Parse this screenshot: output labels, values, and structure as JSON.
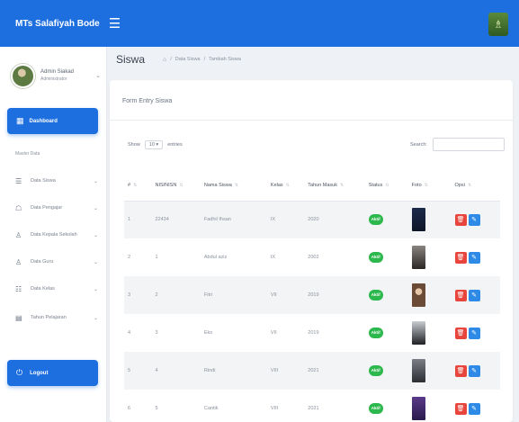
{
  "app": {
    "brand": "MTs Salafiyah Bode"
  },
  "profile": {
    "name": "Admin Siakad",
    "role": "Administrator"
  },
  "sidebar": {
    "dashboard_label": "Dashboard",
    "section_label": "Master Data",
    "items": [
      {
        "label": "Data Siswa",
        "icon": "users-icon",
        "glyph": "☰"
      },
      {
        "label": "Data Pengajar",
        "icon": "user-icon",
        "glyph": "☖"
      },
      {
        "label": "Data Kepala Sekolah",
        "icon": "user-tie-icon",
        "glyph": "♙"
      },
      {
        "label": "Data Guru",
        "icon": "user-icon",
        "glyph": "♙"
      },
      {
        "label": "Data Kelas",
        "icon": "group-icon",
        "glyph": "☷"
      },
      {
        "label": "Tahun Pelajaran",
        "icon": "calendar-icon",
        "glyph": "▤"
      }
    ],
    "logout_label": "Logout"
  },
  "page": {
    "title": "Siswa"
  },
  "breadcrumb": [
    "Data Siswa",
    "Tambah Siswa"
  ],
  "card": {
    "title": "Form Entry Siswa"
  },
  "table_controls": {
    "show_label": "Show",
    "entries_value": "10",
    "entries_label": "entries",
    "search_label": "Search:",
    "search_value": ""
  },
  "table": {
    "columns": [
      "#",
      "NIS/NISN",
      "Nama Siswa",
      "Kelas",
      "Tahun Masuk",
      "Status",
      "Foto",
      "Opsi"
    ],
    "rows": [
      {
        "no": "1",
        "nis": "22434",
        "nama": "Fadhil Ihsan",
        "kelas": "IX",
        "tahun": "2020",
        "status": "Aktif"
      },
      {
        "no": "2",
        "nis": "1",
        "nama": "Abdul aziz",
        "kelas": "IX",
        "tahun": "2002",
        "status": "Aktif"
      },
      {
        "no": "3",
        "nis": "2",
        "nama": "Fitri",
        "kelas": "VII",
        "tahun": "2019",
        "status": "Aktif"
      },
      {
        "no": "4",
        "nis": "3",
        "nama": "Eko",
        "kelas": "VII",
        "tahun": "2019",
        "status": "Aktif"
      },
      {
        "no": "5",
        "nis": "4",
        "nama": "Rindi",
        "kelas": "VIII",
        "tahun": "2021",
        "status": "Aktif"
      },
      {
        "no": "6",
        "nis": "5",
        "nama": "Cantik",
        "kelas": "VIII",
        "tahun": "2021",
        "status": "Aktif"
      }
    ]
  },
  "colors": {
    "primary": "#1d6fe0",
    "success": "#2db84d",
    "danger": "#e8453c",
    "info": "#2d8ae6"
  }
}
